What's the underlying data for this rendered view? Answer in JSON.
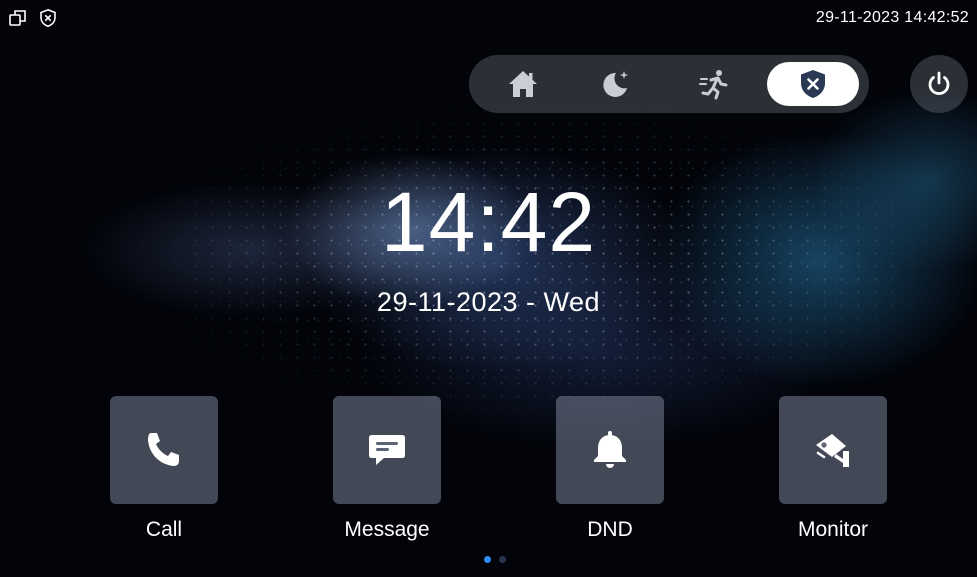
{
  "status_bar": {
    "datetime": "29-11-2023 14:42:52",
    "icons": [
      "multi-window-icon",
      "shield-x-icon"
    ]
  },
  "mode_bar": {
    "modes": [
      {
        "icon": "home-icon",
        "active": false
      },
      {
        "icon": "moon-icon",
        "active": false
      },
      {
        "icon": "running-person-icon",
        "active": false
      },
      {
        "icon": "shield-x-icon",
        "active": true
      }
    ],
    "power_icon": "power-icon"
  },
  "clock": {
    "time": "14:42",
    "date": "29-11-2023 - Wed"
  },
  "apps": [
    {
      "label": "Call",
      "icon": "phone-icon"
    },
    {
      "label": "Message",
      "icon": "message-icon"
    },
    {
      "label": "DND",
      "icon": "bell-icon"
    },
    {
      "label": "Monitor",
      "icon": "camera-icon"
    }
  ],
  "pagination": {
    "pages": 2,
    "current": 1
  },
  "colors": {
    "active_dot": "#2f8cff",
    "inactive_dot": "#2a3550",
    "active_mode_bg": "#ffffff",
    "active_mode_icon": "#2a3a55"
  }
}
